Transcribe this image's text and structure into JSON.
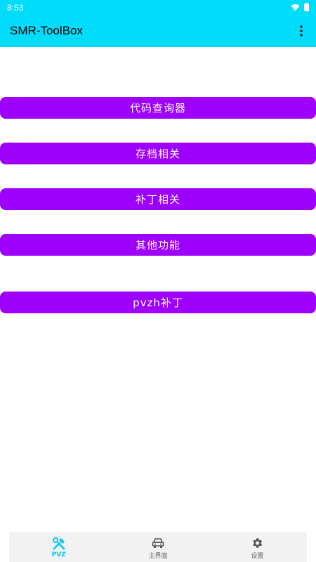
{
  "status_bar": {
    "time": "8:53",
    "icons": [
      "wifi-icon",
      "battery-icon"
    ]
  },
  "app_bar": {
    "title": "SMR-ToolBox",
    "menu_icon": "more-vert-icon",
    "background_color": "#00dcfa"
  },
  "buttons": [
    {
      "label": "代码查询器"
    },
    {
      "label": "存档相关"
    },
    {
      "label": "补丁相关"
    },
    {
      "label": "其他功能"
    },
    {
      "label": "pvzh补丁"
    }
  ],
  "button_color": "#9d00fd",
  "bottom_nav": {
    "items": [
      {
        "label": "PVZ",
        "icon": "tools-icon",
        "active": true
      },
      {
        "label": "主界面",
        "icon": "car-icon",
        "active": false
      },
      {
        "label": "设置",
        "icon": "gear-icon",
        "active": false
      }
    ],
    "active_color": "#00c8f0"
  }
}
